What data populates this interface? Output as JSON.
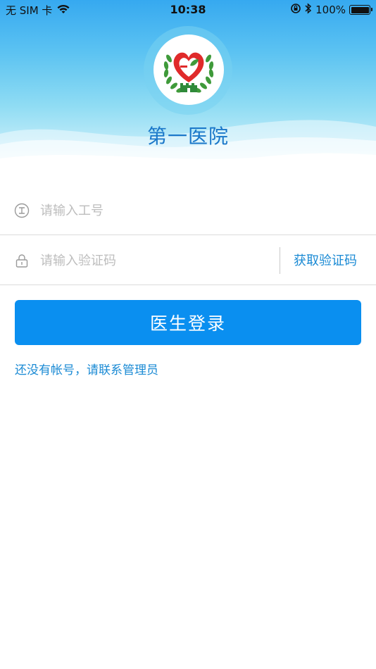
{
  "status_bar": {
    "carrier": "无 SIM 卡",
    "time": "10:38",
    "battery": "100%",
    "icons": [
      "wifi-icon",
      "orientation-lock-icon",
      "bluetooth-icon",
      "battery-icon"
    ]
  },
  "header": {
    "hospital_name": "第一医院",
    "logo": "hospital-heart-wreath-logo"
  },
  "form": {
    "employee_id": {
      "value": "",
      "placeholder": "请输入工号",
      "icon": "id-badge-icon"
    },
    "verify_code": {
      "value": "",
      "placeholder": "请输入验证码",
      "icon": "lock-icon"
    },
    "get_code_label": "获取验证码",
    "login_label": "医生登录",
    "no_account_text": "还没有帐号，请联系管理员"
  },
  "colors": {
    "primary": "#0a8ff0",
    "link": "#1a8ad4",
    "title": "#1a77c9",
    "heart_red": "#e02a2a",
    "wreath_green": "#3f9a3a"
  }
}
